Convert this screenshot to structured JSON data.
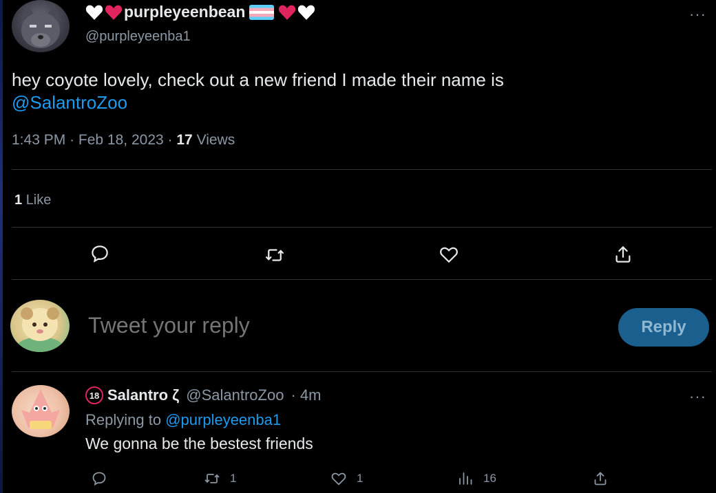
{
  "colors": {
    "background": "#000000",
    "text": "#e7e9ea",
    "muted": "#8b98a5",
    "accent": "#1d9bf0",
    "heart_red": "#e0245e",
    "reply_button_bg": "#1a5f8e",
    "divider": "#2f3336"
  },
  "tweet": {
    "display_name": "purpleyeenbean",
    "handle": "@purpleyeenba1",
    "more_label": "···",
    "text": "hey coyote lovely, check out a new friend I made their name is",
    "mention": "@SalantroZoo",
    "time": "1:43 PM",
    "date": "Feb 18, 2023",
    "sep": "·",
    "views_count": "17",
    "views_label": "Views",
    "likes_count": "1",
    "likes_label": "Like",
    "icons": [
      "comment-icon",
      "retweet-icon",
      "heart-icon",
      "share-icon"
    ]
  },
  "composer": {
    "placeholder": "Tweet your reply",
    "button_label": "Reply"
  },
  "reply": {
    "age_badge": "18",
    "display_name": "Salantro ζ",
    "handle": "@SalantroZoo",
    "time": "· 4m",
    "more_label": "···",
    "replying_prefix": "Replying to",
    "replying_handle": "@purpleyeenba1",
    "text": "We gonna be the bestest friends",
    "retweets": "1",
    "likes": "1",
    "views": "16"
  }
}
